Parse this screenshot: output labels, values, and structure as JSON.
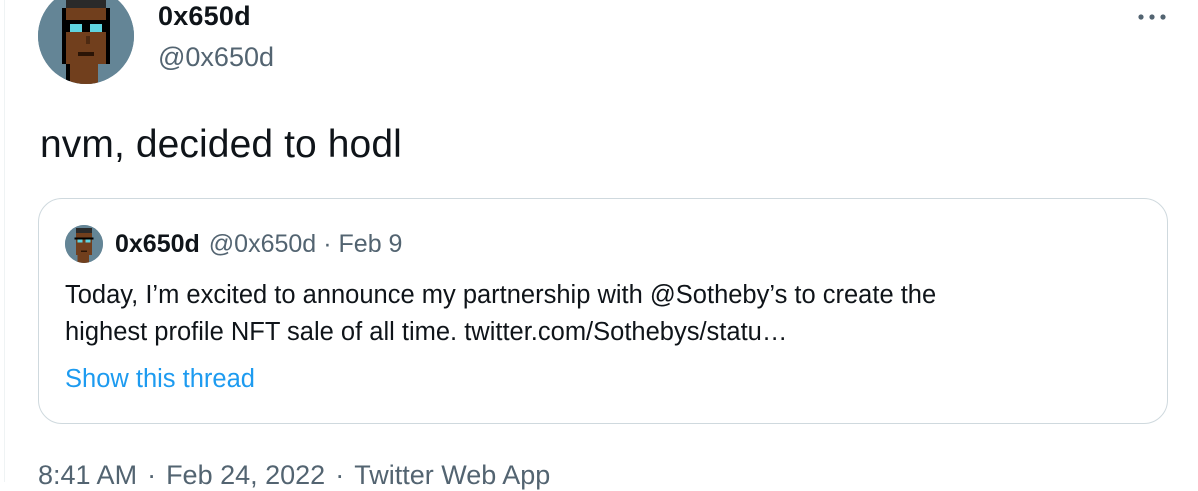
{
  "tweet": {
    "author": {
      "name": "0x650d",
      "handle": "@0x650d",
      "avatar_icon": "pixel-punk-avatar-icon"
    },
    "more_icon": "more-dots-icon",
    "text": "nvm, decided to hodl",
    "quote": {
      "author_name": "0x650d",
      "author_handle": "@0x650d",
      "separator": "·",
      "date": "Feb 9",
      "text_lines": [
        "Today, I’m excited to announce my partnership with @Sotheby’s to create the",
        "highest profile NFT sale of all time. twitter.com/Sothebys/statu…"
      ],
      "show_thread": "Show this thread"
    },
    "meta": {
      "time": "8:41 AM",
      "separator": "·",
      "date": "Feb 24, 2022",
      "source": "Twitter Web App"
    }
  },
  "colors": {
    "text_primary": "#0f1419",
    "text_secondary": "#536471",
    "link": "#1d9bf0",
    "border": "#cfd9de",
    "avatar_bg": "#648596"
  }
}
